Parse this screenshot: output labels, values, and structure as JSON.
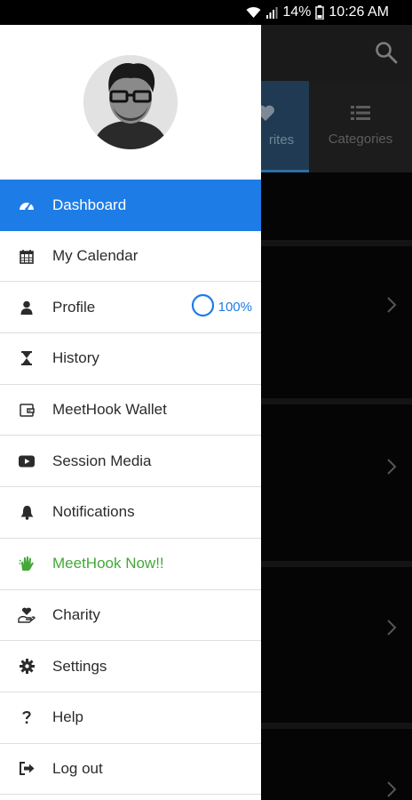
{
  "status_bar": {
    "battery": "14%",
    "time": "10:26 AM",
    "icons": [
      "wifi-icon",
      "signal-icon",
      "battery-icon"
    ]
  },
  "background_app": {
    "tabs": [
      {
        "label": "rites",
        "icon": "heart-icon",
        "selected": true
      },
      {
        "label": "Categories",
        "icon": "list-icon",
        "selected": false
      }
    ]
  },
  "drawer": {
    "menu": [
      {
        "label": "Dashboard",
        "icon": "dashboard-icon",
        "active": true
      },
      {
        "label": "My Calendar",
        "icon": "calendar-icon"
      },
      {
        "label": "Profile",
        "icon": "user-icon",
        "progress": "100%"
      },
      {
        "label": "History",
        "icon": "hourglass-icon"
      },
      {
        "label": "MeetHook Wallet",
        "icon": "wallet-icon"
      },
      {
        "label": "Session Media",
        "icon": "youtube-icon"
      },
      {
        "label": "Notifications",
        "icon": "bell-icon"
      },
      {
        "label": "MeetHook Now!!",
        "icon": "hand-icon",
        "highlight_color": "#43a838"
      },
      {
        "label": "Charity",
        "icon": "charity-icon"
      },
      {
        "label": "Settings",
        "icon": "gear-icon"
      },
      {
        "label": "Help",
        "icon": "question-icon"
      },
      {
        "label": "Log out",
        "icon": "logout-icon"
      }
    ]
  },
  "colors": {
    "accent": "#1e7ce6",
    "green": "#43a838"
  }
}
